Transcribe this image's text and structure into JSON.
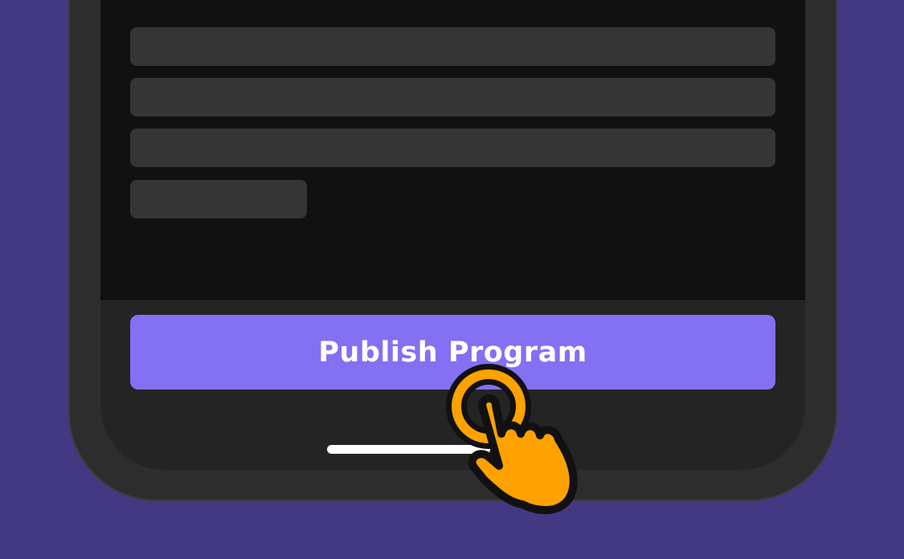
{
  "screen": {
    "publish_button_label": "Publish Program"
  },
  "colors": {
    "background": "#433882",
    "device_frame": "#2d2d2d",
    "content_area": "#111111",
    "skeleton": "#353535",
    "button": "#8470f3",
    "button_text": "#ffffff",
    "pointer_icon": "#ffa100"
  },
  "icons": {
    "pointer": "tap-hand-icon"
  }
}
